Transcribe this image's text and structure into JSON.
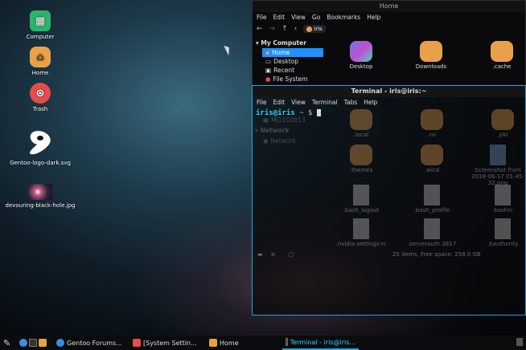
{
  "desktop": {
    "icons": [
      {
        "label": "Computer",
        "icon": "computer-icon",
        "color": "#2bb46b",
        "glyph": "▦"
      },
      {
        "label": "Home",
        "icon": "home-icon",
        "color": "#e8a04a",
        "glyph": "⌂"
      },
      {
        "label": "Trash",
        "icon": "trash-icon",
        "color": "#e84b4b",
        "glyph": "⊛"
      },
      {
        "label": "Gentoo-logo-dark.svg",
        "icon": "gentoo-logo-icon",
        "color": "#ffffff",
        "glyph": "G"
      },
      {
        "label": "devouring-black-hole.jpg",
        "icon": "image-file-icon",
        "color": "#6a4a6a",
        "glyph": ""
      }
    ]
  },
  "filemanager": {
    "title": "Home",
    "menu": [
      "File",
      "Edit",
      "View",
      "Go",
      "Bookmarks",
      "Help"
    ],
    "location": "iris",
    "sidebar_header": "My Computer",
    "sidebar": [
      "Home",
      "Desktop",
      "Recent",
      "File System"
    ],
    "items": [
      "Desktop",
      "Downloads",
      ".cache"
    ]
  },
  "terminal": {
    "title": "Terminal - iris@iris:~",
    "menu": [
      "File",
      "Edit",
      "View",
      "Terminal",
      "Tabs",
      "Help"
    ],
    "prompt_user": "iris@iris",
    "prompt_dir": "~ $"
  },
  "behind": {
    "sidebar_items": [
      "MJ11C0813",
      "Network",
      "Network"
    ],
    "files": [
      ".local",
      ".nv",
      ".pki",
      ".themes",
      ".wicd",
      "Screenshot from 2018-06-17 01-45-32.png",
      ".bash_logout",
      ".bash_profile",
      ".bashrc",
      ".nvidia-settings-rc",
      ".serverauth.3817",
      ".Xauthority"
    ],
    "status": "25 items, Free space: 258.0 GB"
  },
  "taskbar": {
    "windows": [
      {
        "label": "Gentoo Forums...",
        "color": "#3a8ee6",
        "active": false
      },
      {
        "label": "[System Settin...",
        "color": "#e84b4b",
        "active": false
      },
      {
        "label": "Home",
        "color": "#e8a04a",
        "active": false
      },
      {
        "label": "Terminal - iris@iris...",
        "color": "#333333",
        "active": true
      }
    ]
  }
}
